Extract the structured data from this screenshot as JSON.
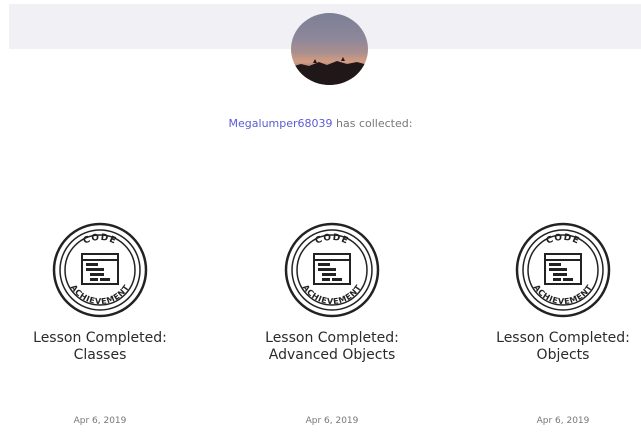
{
  "profile": {
    "username": "Megalumper68039",
    "collected_suffix": " has collected:"
  },
  "badge_text": {
    "top": "CODE",
    "bottom": "ACHIEVEMENT"
  },
  "achievements": [
    {
      "title_line1": "Lesson Completed:",
      "title_line2": "Classes",
      "date": "Apr 6, 2019"
    },
    {
      "title_line1": "Lesson Completed:",
      "title_line2": "Advanced Objects",
      "date": "Apr 6, 2019"
    },
    {
      "title_line1": "Lesson Completed:",
      "title_line2": "Objects",
      "date": "Apr 6, 2019"
    }
  ]
}
